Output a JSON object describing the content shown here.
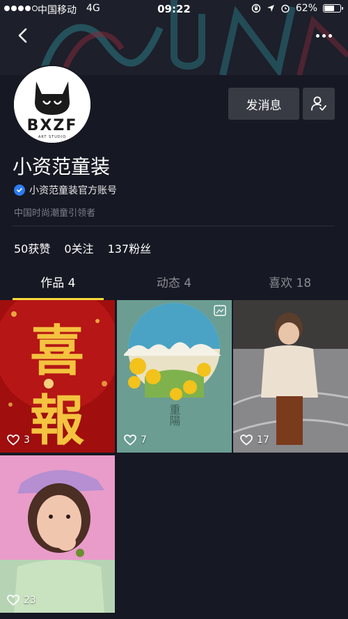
{
  "status_bar": {
    "carrier": "中国移动",
    "network": "4G",
    "time": "09:22",
    "battery_percent": "62%",
    "battery_level": 0.62
  },
  "profile": {
    "avatar_text": "BXZF",
    "avatar_subtext": "ART STUDIO",
    "display_name": "小资范童装",
    "verified_label": "小资范童装官方账号",
    "bio": "中国时尚潮童引领者"
  },
  "actions": {
    "send_message_label": "发消息"
  },
  "stats": [
    {
      "label": "50获赞"
    },
    {
      "label": "0关注"
    },
    {
      "label": "137粉丝"
    }
  ],
  "tabs": [
    {
      "label": "作品 4",
      "active": true
    },
    {
      "label": "动态 4",
      "active": false
    },
    {
      "label": "喜欢 18",
      "active": false
    }
  ],
  "videos": [
    {
      "likes": "3",
      "overlay_text_1": "喜",
      "overlay_text_2": "報"
    },
    {
      "likes": "7",
      "overlay_text": "重陽"
    },
    {
      "likes": "17"
    },
    {
      "likes": "23"
    }
  ],
  "colors": {
    "background": "#161823",
    "accent_tab": "#fdd938",
    "verified": "#2d7cf1",
    "button_bg": "#393b44"
  }
}
